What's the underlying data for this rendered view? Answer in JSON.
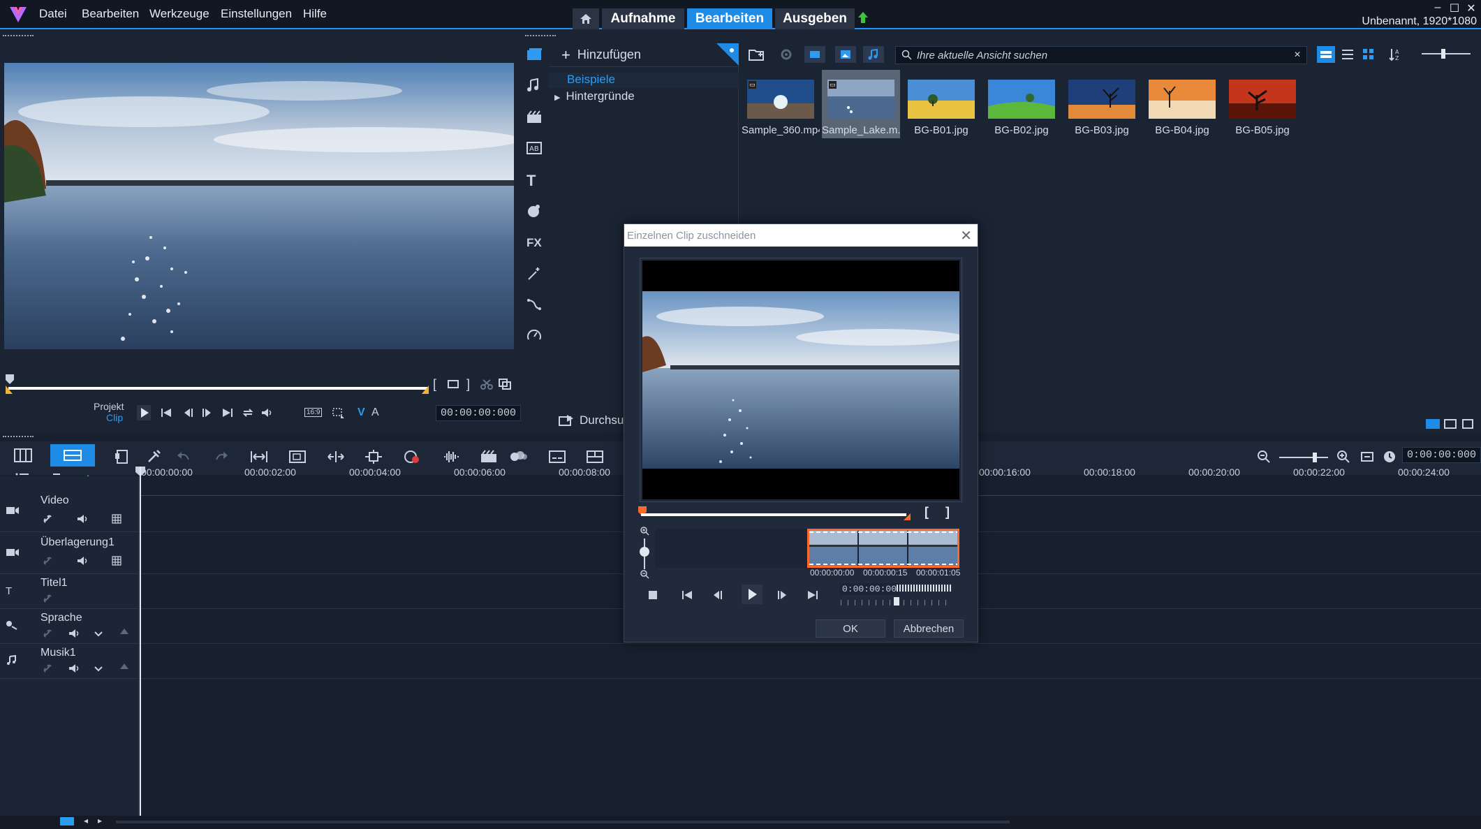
{
  "menubar": {
    "items": [
      "Datei",
      "Bearbeiten",
      "Werkzeuge",
      "Einstellungen",
      "Hilfe"
    ],
    "tabs": {
      "aufnahme": "Aufnahme",
      "bearbeiten": "Bearbeiten",
      "ausgeben": "Ausgeben"
    },
    "project_info": "Unbenannt, 1920*1080",
    "window_buttons": {
      "minimize": "–",
      "maximize": "☐",
      "close": "✕"
    }
  },
  "preview": {
    "mode_project": "Projekt",
    "mode_clip": "Clip",
    "aspect": "16:9",
    "v_label": "V",
    "a_label": "A",
    "timecode": "00:00:00:000"
  },
  "library": {
    "add_label": "Hinzufügen",
    "folders": [
      "Beispiele",
      "Hintergründe"
    ],
    "browse_label": "Durchsu",
    "search_placeholder": "Ihre aktuelle Ansicht suchen",
    "thumbs": [
      {
        "label": "Sample_360.mp4"
      },
      {
        "label": "Sample_Lake.m..."
      },
      {
        "label": "BG-B01.jpg"
      },
      {
        "label": "BG-B02.jpg"
      },
      {
        "label": "BG-B03.jpg"
      },
      {
        "label": "BG-B04.jpg"
      },
      {
        "label": "BG-B05.jpg"
      }
    ]
  },
  "timeline": {
    "ruler": [
      "00:00:00:00",
      "00:00:02:00",
      "00:00:04:00",
      "00:00:06:00",
      "00:00:08:00",
      "00:00:16:00",
      "00:00:18:00",
      "00:00:20:00",
      "00:00:22:00",
      "00:00:24:00"
    ],
    "timecode": "0:00:00:000",
    "tracks": [
      "Video",
      "Überlagerung1",
      "Titel1",
      "Sprache",
      "Musik1"
    ]
  },
  "dialog": {
    "title": "Einzelnen Clip zuschneiden",
    "film_labels": [
      "00:00:00:00",
      "00:00:00:15",
      "00:00:01:05"
    ],
    "timecode": "0:00:00:00",
    "ok_label": "OK",
    "cancel_label": "Abbrechen",
    "bracket_in": "[",
    "bracket_out": "]"
  },
  "colors": {
    "accent": "#1e8ce6",
    "trim_marker": "#ff6a2b",
    "background": "#1b2433"
  }
}
